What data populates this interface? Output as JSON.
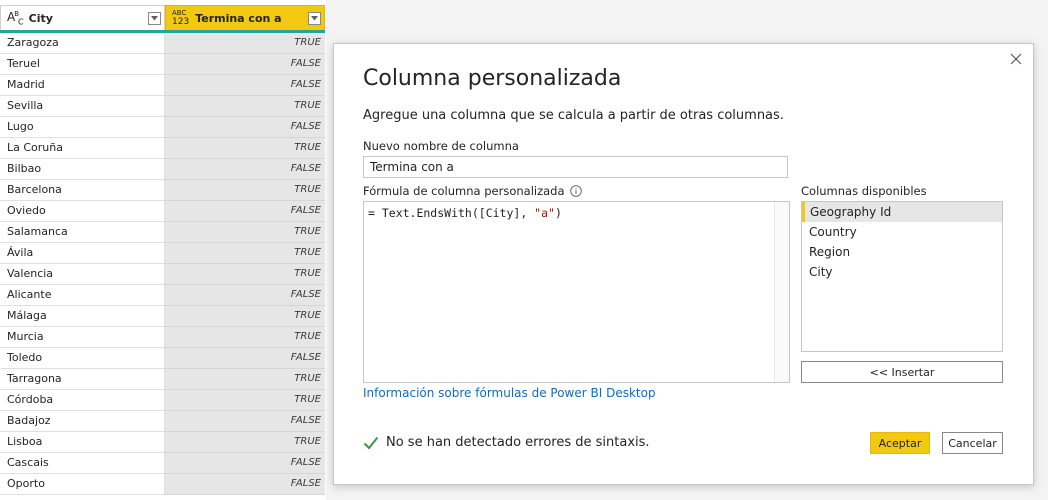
{
  "grid": {
    "columns": [
      {
        "type_icon": "ABC",
        "label": "City"
      },
      {
        "type_icon": "ABC 123",
        "label": "Termina con a"
      }
    ],
    "rows": [
      {
        "city": "Zaragoza",
        "value": "TRUE"
      },
      {
        "city": "Teruel",
        "value": "FALSE"
      },
      {
        "city": "Madrid",
        "value": "FALSE"
      },
      {
        "city": "Sevilla",
        "value": "TRUE"
      },
      {
        "city": "Lugo",
        "value": "FALSE"
      },
      {
        "city": "La Coruña",
        "value": "TRUE"
      },
      {
        "city": "Bilbao",
        "value": "FALSE"
      },
      {
        "city": "Barcelona",
        "value": "TRUE"
      },
      {
        "city": "Oviedo",
        "value": "FALSE"
      },
      {
        "city": "Salamanca",
        "value": "TRUE"
      },
      {
        "city": "Ávila",
        "value": "TRUE"
      },
      {
        "city": "Valencia",
        "value": "TRUE"
      },
      {
        "city": "Alicante",
        "value": "FALSE"
      },
      {
        "city": "Málaga",
        "value": "TRUE"
      },
      {
        "city": "Murcia",
        "value": "TRUE"
      },
      {
        "city": "Toledo",
        "value": "FALSE"
      },
      {
        "city": "Tarragona",
        "value": "TRUE"
      },
      {
        "city": "Córdoba",
        "value": "TRUE"
      },
      {
        "city": "Badajoz",
        "value": "FALSE"
      },
      {
        "city": "Lisboa",
        "value": "TRUE"
      },
      {
        "city": "Cascais",
        "value": "FALSE"
      },
      {
        "city": "Oporto",
        "value": "FALSE"
      }
    ],
    "colors": {
      "quality_bar": "#26a69a",
      "selected_header": "#f2c811"
    }
  },
  "dialog": {
    "title": "Columna personalizada",
    "description": "Agregue una columna que se calcula a partir de otras columnas.",
    "name_label": "Nuevo nombre de columna",
    "name_value": "Termina con a",
    "formula_label": "Fórmula de columna personalizada",
    "formula": {
      "prefix": "= Text.EndsWith([City], ",
      "string_literal": "\"a\"",
      "suffix": ")"
    },
    "columns_label": "Columnas disponibles",
    "available_columns": [
      "Geography Id",
      "Country",
      "Region",
      "City"
    ],
    "selected_column": "Geography Id",
    "insert_label": "<< Insertar",
    "help_link": "Información sobre fórmulas de Power BI Desktop",
    "status": "No se han detectado errores de sintaxis.",
    "ok_label": "Aceptar",
    "cancel_label": "Cancelar",
    "icons": {
      "close": "close-icon",
      "info": "info-icon",
      "status": "checkmark-icon"
    },
    "colors": {
      "accent": "#f2c811",
      "link": "#0f6cbd",
      "check": "#3a9a3a"
    }
  }
}
